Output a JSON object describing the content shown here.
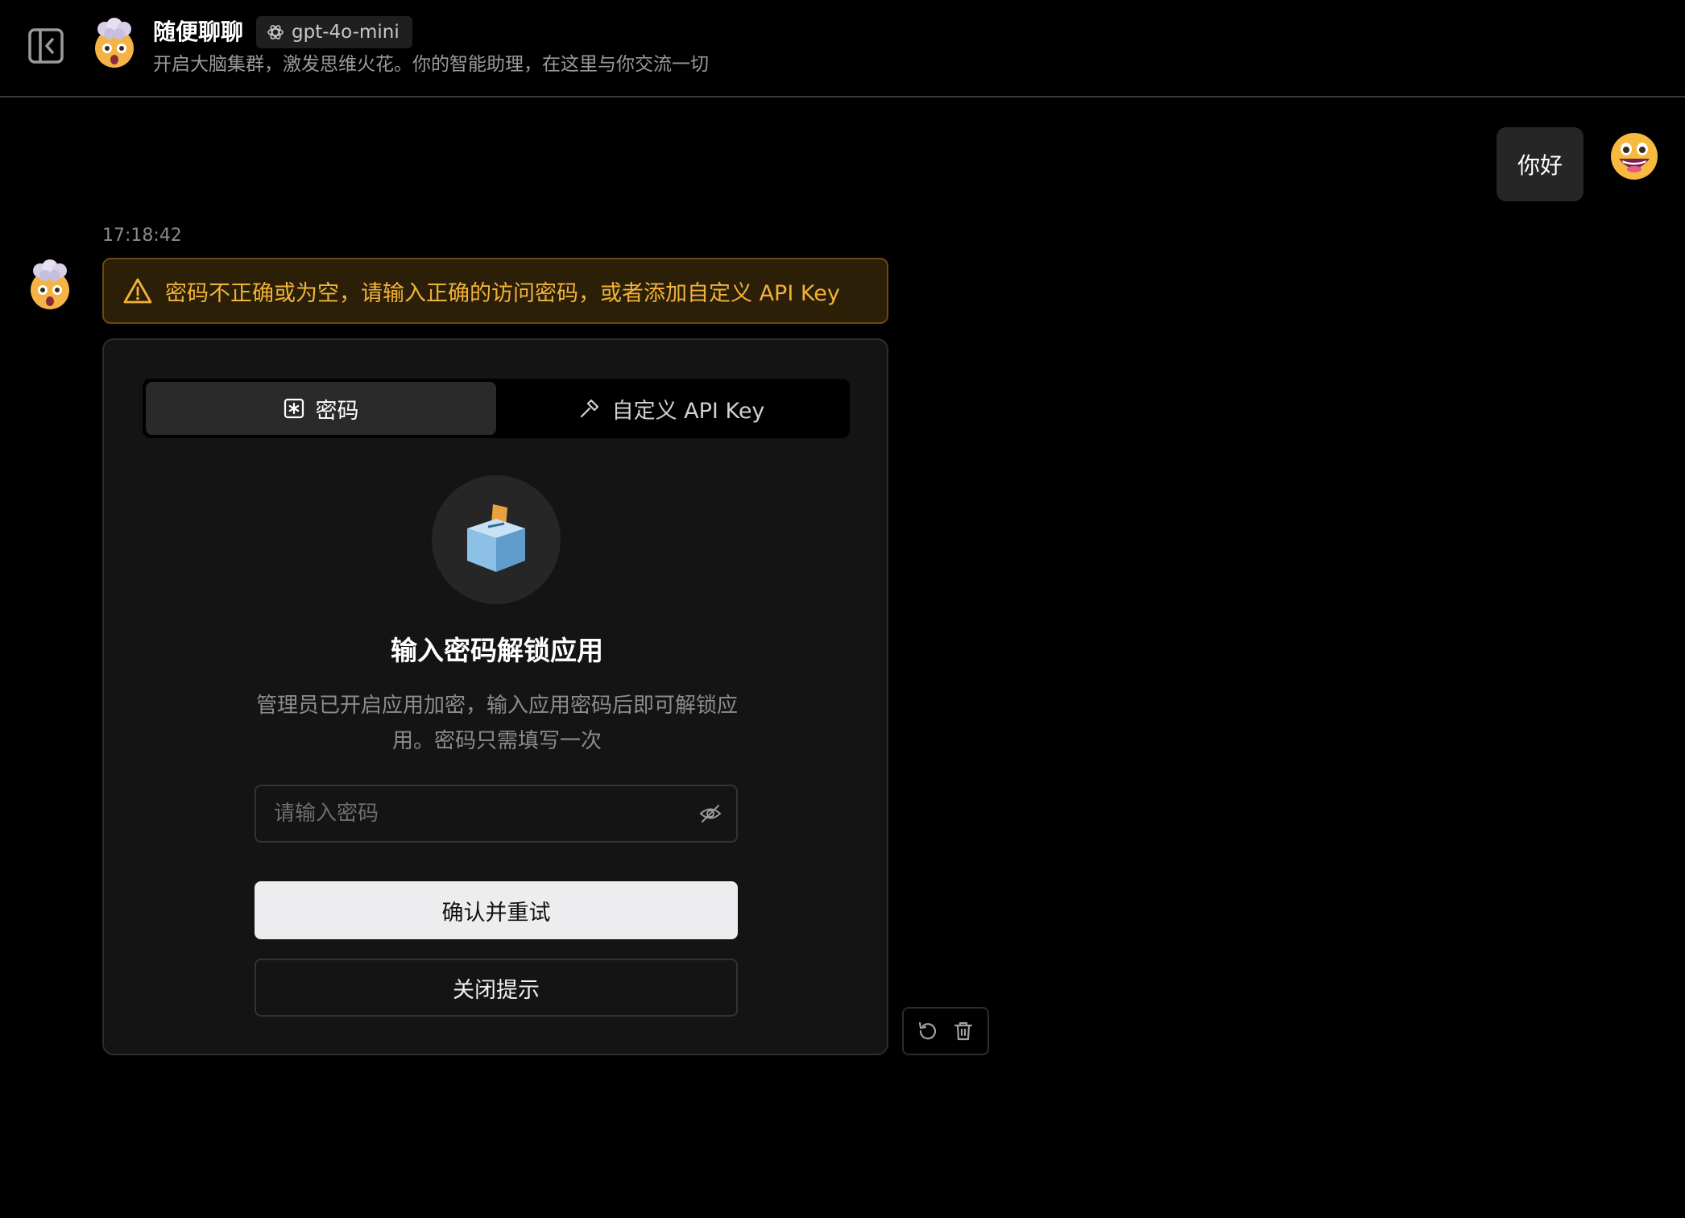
{
  "header": {
    "title": "随便聊聊",
    "model": "gpt-4o-mini",
    "description": "开启大脑集群，激发思维火花。你的智能助理，在这里与你交流一切",
    "toggle_icon": "sidebar-collapse-icon",
    "avatar_icon": "mind-blown-emoji-icon"
  },
  "user_message": {
    "text": "你好",
    "avatar_icon": "grinning-emoji-icon"
  },
  "assistant_message": {
    "timestamp": "17:18:42",
    "avatar_icon": "mind-blown-emoji-icon",
    "alert": {
      "text": "密码不正确或为空，请输入正确的访问密码，或者添加自定义 API Key",
      "icon": "warning-icon",
      "color": "#f0b23a"
    }
  },
  "unlock_card": {
    "tabs": [
      {
        "label": "密码",
        "icon": "asterisk-box-icon",
        "active": true
      },
      {
        "label": "自定义 API Key",
        "icon": "hammer-icon",
        "active": false
      }
    ],
    "illustration_icon": "ballot-box-icon",
    "title": "输入密码解锁应用",
    "description": "管理员已开启应用加密，输入应用密码后即可解锁应用。密码只需填写一次",
    "password_placeholder": "请输入密码",
    "password_value": "",
    "confirm_label": "确认并重试",
    "close_label": "关闭提示"
  },
  "message_actions": [
    {
      "name": "regenerate-icon"
    },
    {
      "name": "delete-icon"
    }
  ],
  "colors": {
    "background": "#000000",
    "alert_bg": "#2b1f07",
    "alert_border": "#6b4a0f",
    "alert_text": "#f0b23a",
    "card_bg": "#141414",
    "primary_button_bg": "#ededf0"
  }
}
